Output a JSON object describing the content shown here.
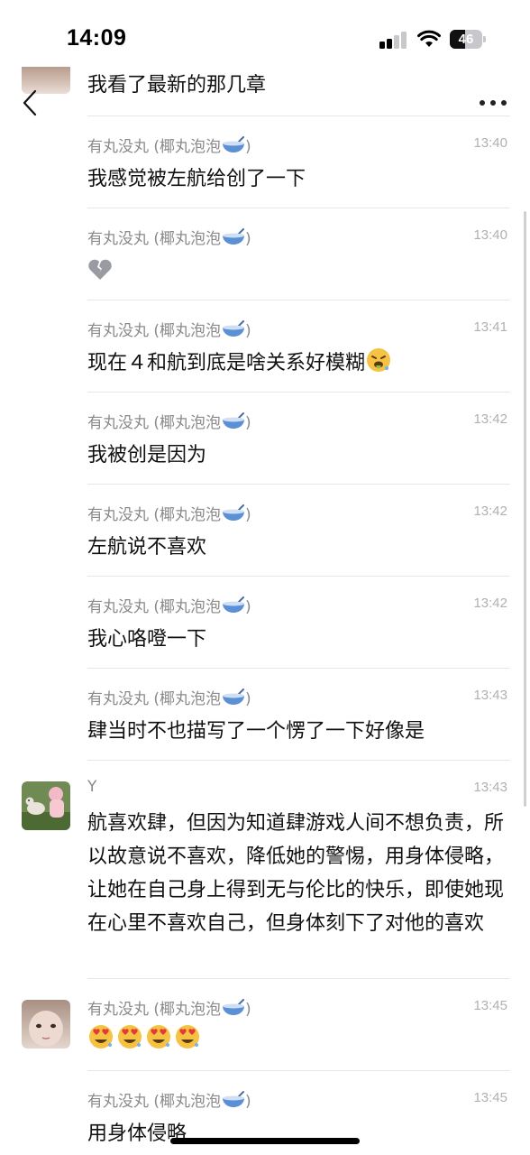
{
  "status_bar": {
    "time": "14:09",
    "battery_level": "46",
    "battery_fraction": 0.46
  },
  "nav": {
    "back_icon": "chevron-left-icon",
    "more_icon": "ellipsis-icon"
  },
  "partial_message": {
    "text": "我看了最新的那几章"
  },
  "sender_names": {
    "friend": "有丸没丸 (椰丸泡泡",
    "friend_emoji": "bowl-with-spoon-icon",
    "y": "Y"
  },
  "messages": [
    {
      "sender": "有丸没丸 (椰丸泡泡",
      "suffix": ")",
      "time": "13:40",
      "text": "我感觉被左航给创了一下"
    },
    {
      "sender": "有丸没丸 (椰丸泡泡",
      "suffix": ")",
      "time": "13:40",
      "text": "",
      "emoji": "broken-heart-icon"
    },
    {
      "sender": "有丸没丸 (椰丸泡泡",
      "suffix": ")",
      "time": "13:41",
      "text": "现在４和航到底是啥关系好模糊",
      "emoji": "face-vomiting-icon"
    },
    {
      "sender": "有丸没丸 (椰丸泡泡",
      "suffix": ")",
      "time": "13:42",
      "text": "我被创是因为"
    },
    {
      "sender": "有丸没丸 (椰丸泡泡",
      "suffix": ")",
      "time": "13:42",
      "text": "左航说不喜欢"
    },
    {
      "sender": "有丸没丸 (椰丸泡泡",
      "suffix": ")",
      "time": "13:42",
      "text": "我心咯噔一下"
    },
    {
      "sender": "有丸没丸 (椰丸泡泡",
      "suffix": ")",
      "time": "13:43",
      "text": "肆当时不也描写了一个愣了一下好像是"
    },
    {
      "sender": "Y",
      "suffix": "",
      "time": "13:43",
      "text": "航喜欢肆，但因为知道肆游戏人间不想负责，所以故意说不喜欢，降低她的警惕，用身体侵略，让她在自己身上得到无与伦比的快乐，即使她现在心里不喜欢自己，但身体刻下了对他的喜欢"
    },
    {
      "sender": "有丸没丸 (椰丸泡泡",
      "suffix": ")",
      "time": "13:45",
      "text": "",
      "emoji": "smiling-face-with-heart-eyes-icon",
      "emoji_count": 4
    },
    {
      "sender": "有丸没丸 (椰丸泡泡",
      "suffix": ")",
      "time": "13:45",
      "text": "用身体侵略"
    }
  ],
  "colors": {
    "background": "#ffffff",
    "text": "#111111",
    "meta_text": "#8a8a8a",
    "timestamp": "#b0b0b0",
    "separator": "#e6e6e6"
  }
}
